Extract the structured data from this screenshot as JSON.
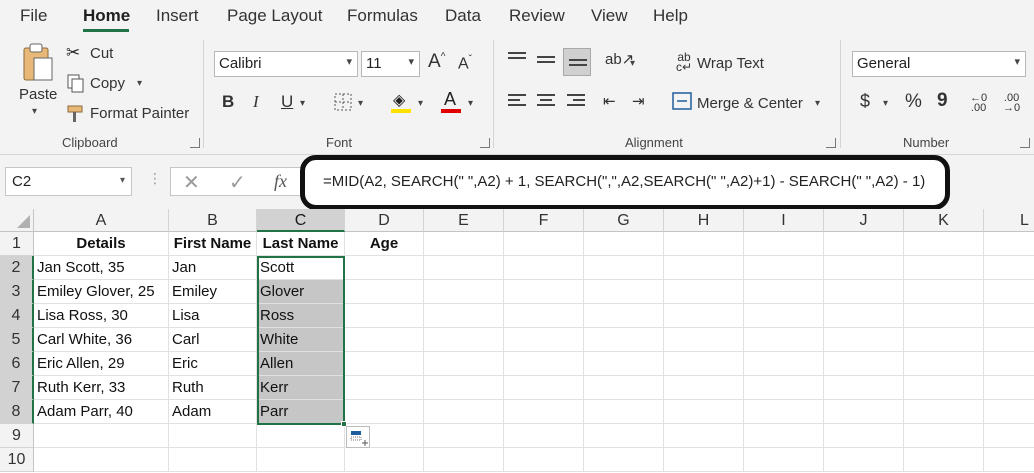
{
  "menu": {
    "items": [
      "File",
      "Home",
      "Insert",
      "Page Layout",
      "Formulas",
      "Data",
      "Review",
      "View",
      "Help"
    ],
    "active": "Home"
  },
  "clipboard": {
    "paste_label": "Paste",
    "cut_label": "Cut",
    "copy_label": "Copy",
    "format_painter_label": "Format Painter",
    "group_label": "Clipboard"
  },
  "font": {
    "name": "Calibri",
    "size": "11",
    "group_label": "Font"
  },
  "alignment": {
    "wrap_text_label": "Wrap Text",
    "merge_center_label": "Merge & Center",
    "group_label": "Alignment"
  },
  "number": {
    "format": "General",
    "group_label": "Number",
    "currency_symbol": "$",
    "percent_symbol": "%",
    "comma_symbol": "9"
  },
  "formula_bar": {
    "name_box": "C2",
    "formula": "=MID(A2, SEARCH(\" \",A2) + 1, SEARCH(\",\",A2,SEARCH(\" \",A2)+1) - SEARCH(\" \",A2) - 1)",
    "fx_label": "fx"
  },
  "sheet": {
    "columns": [
      "A",
      "B",
      "C",
      "D",
      "E",
      "F",
      "G",
      "H",
      "I",
      "J",
      "K",
      "L"
    ],
    "rows": [
      "1",
      "2",
      "3",
      "4",
      "5",
      "6",
      "7",
      "8",
      "9",
      "10"
    ],
    "headers": [
      "Details",
      "First Name",
      "Last Name",
      "Age"
    ],
    "data": [
      [
        "Jan Scott, 35",
        "Jan",
        "Scott"
      ],
      [
        "Emiley Glover, 25",
        "Emiley",
        "Glover"
      ],
      [
        "Lisa Ross, 30",
        "Lisa",
        "Ross"
      ],
      [
        "Carl White, 36",
        "Carl",
        "White"
      ],
      [
        "Eric Allen, 29",
        "Eric",
        "Allen"
      ],
      [
        "Ruth Kerr, 33",
        "Ruth",
        "Kerr"
      ],
      [
        "Adam Parr, 40",
        "Adam",
        "Parr"
      ]
    ]
  },
  "colors": {
    "accent": "#217346",
    "font_color_red": "#e00000",
    "highlight_yellow": "#ffe100"
  }
}
